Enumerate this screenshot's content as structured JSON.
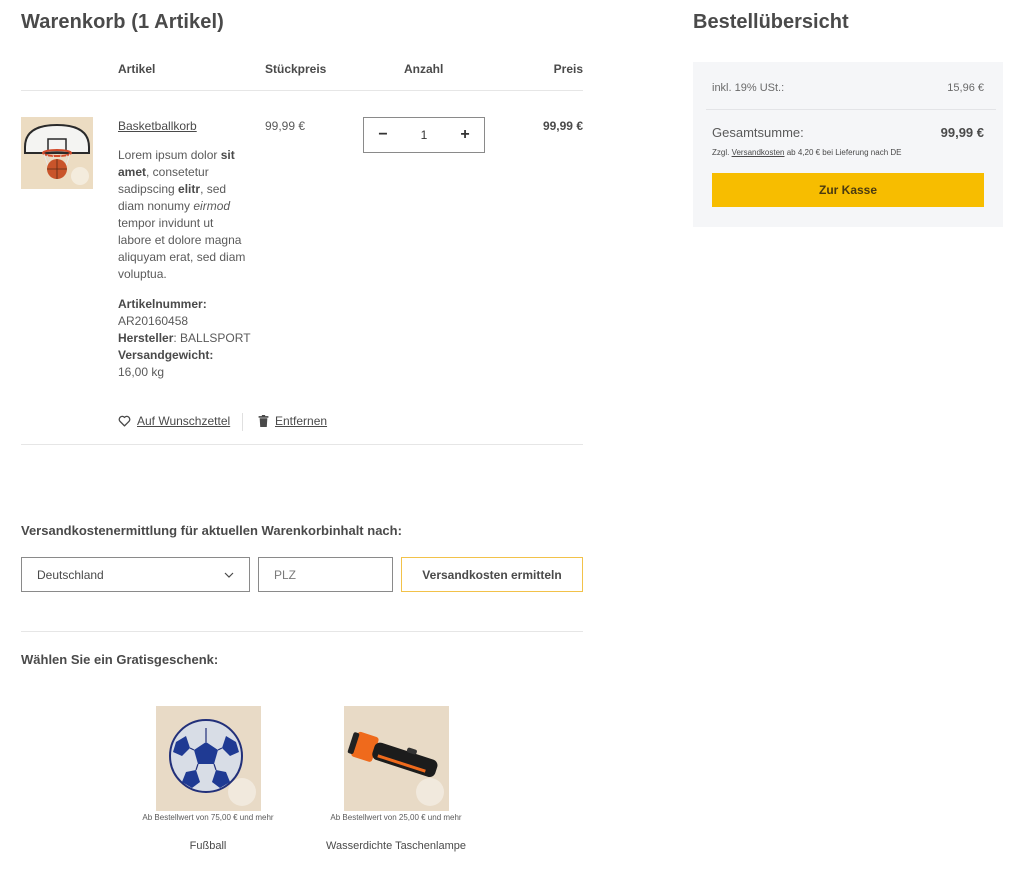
{
  "cart": {
    "title": "Warenkorb (1 Artikel)",
    "columns": {
      "item": "Artikel",
      "unit_price": "Stückpreis",
      "quantity": "Anzahl",
      "price": "Preis"
    },
    "items": [
      {
        "name": "Basketballkorb",
        "description_parts": [
          {
            "t": "Lorem ipsum dolor ",
            "s": "n"
          },
          {
            "t": "sit amet",
            "s": "b"
          },
          {
            "t": ", consetetur sadipscing ",
            "s": "n"
          },
          {
            "t": "elitr",
            "s": "b"
          },
          {
            "t": ", sed diam nonumy ",
            "s": "n"
          },
          {
            "t": "eirmod",
            "s": "i"
          },
          {
            "t": " tempor invidunt ut labore et dolore magna aliquyam erat, sed diam voluptua.",
            "s": "n"
          }
        ],
        "article_number_label": "Artikelnummer:",
        "article_number": "AR20160458",
        "manufacturer_label": "Hersteller",
        "manufacturer": ": BALLSPORT",
        "weight_label": "Versandgewicht:",
        "weight": "16,00 kg",
        "unit_price": "99,99 €",
        "quantity": "1",
        "qty_minus": "−",
        "qty_plus": "+",
        "line_price": "99,99 €",
        "wishlist_label": "Auf Wunschzettel",
        "remove_label": "Entfernen"
      }
    ]
  },
  "shipping": {
    "title": "Versandkostenermittlung für aktuellen Warenkorbinhalt nach:",
    "country": "Deutschland",
    "zip_placeholder": "PLZ",
    "button": "Versandkosten ermitteln"
  },
  "gifts": {
    "title": "Wählen Sie ein Gratisgeschenk:",
    "items": [
      {
        "condition": "Ab Bestellwert von 75,00 € und mehr",
        "name": "Fußball"
      },
      {
        "condition": "Ab Bestellwert von 25,00 € und mehr",
        "name": "Wasserdichte Taschenlampe"
      }
    ]
  },
  "summary": {
    "title": "Bestellübersicht",
    "tax_label": "inkl. 19% USt.:",
    "tax_value": "15,96 €",
    "total_label": "Gesamtsumme:",
    "total_value": "99,99 €",
    "shipping_note_prefix": "Zzgl. ",
    "shipping_note_link": "Versandkosten",
    "shipping_note_suffix": " ab 4,20 € bei Lieferung nach DE",
    "checkout": "Zur Kasse"
  },
  "colors": {
    "accent": "#f7bd00",
    "accent_border": "#f2c24a",
    "summary_bg": "#f5f6f8"
  }
}
